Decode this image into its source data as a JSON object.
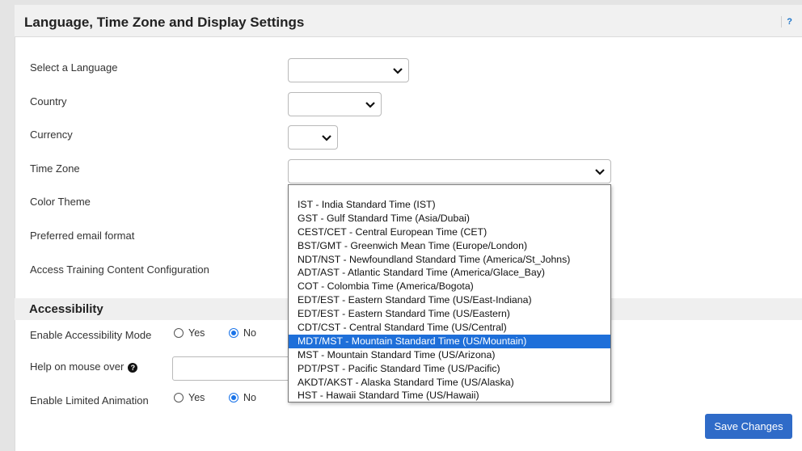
{
  "page": {
    "title": "Language, Time Zone and Display Settings",
    "help_label": "?"
  },
  "fields": {
    "language": {
      "label": "Select a Language",
      "value": ""
    },
    "country": {
      "label": "Country",
      "value": ""
    },
    "currency": {
      "label": "Currency",
      "value": ""
    },
    "time_zone": {
      "label": "Time Zone",
      "value": ""
    },
    "color_theme": {
      "label": "Color Theme"
    },
    "email_format": {
      "label": "Preferred email format"
    },
    "training_config": {
      "label": "Access Training Content Configuration"
    }
  },
  "accessibility": {
    "title": "Accessibility",
    "mode": {
      "label": "Enable Accessibility Mode",
      "yes": "Yes",
      "no": "No",
      "selected": "No"
    },
    "help_mouse_over": {
      "label": "Help on mouse over",
      "value": ""
    },
    "limited_animation": {
      "label": "Enable Limited Animation",
      "yes": "Yes",
      "no": "No",
      "selected": "No"
    }
  },
  "timezone_options": [
    "IST - India Standard Time (IST)",
    "GST - Gulf Standard Time (Asia/Dubai)",
    "CEST/CET - Central European Time (CET)",
    "BST/GMT - Greenwich Mean Time (Europe/London)",
    "NDT/NST - Newfoundland Standard Time (America/St_Johns)",
    "ADT/AST - Atlantic Standard Time (America/Glace_Bay)",
    "COT - Colombia Time (America/Bogota)",
    "EDT/EST - Eastern Standard Time (US/East-Indiana)",
    "EDT/EST - Eastern Standard Time (US/Eastern)",
    "CDT/CST - Central Standard Time (US/Central)",
    "MDT/MST - Mountain Standard Time (US/Mountain)",
    "MST - Mountain Standard Time (US/Arizona)",
    "PDT/PST - Pacific Standard Time (US/Pacific)",
    "AKDT/AKST - Alaska Standard Time (US/Alaska)",
    "HST - Hawaii Standard Time (US/Hawaii)"
  ],
  "timezone_highlighted": "MDT/MST - Mountain Standard Time (US/Mountain)",
  "actions": {
    "save_label": "Save Changes"
  },
  "colors": {
    "accent": "#1e6fd9",
    "save_button": "#2f6bc8",
    "link": "#1a73c8"
  }
}
